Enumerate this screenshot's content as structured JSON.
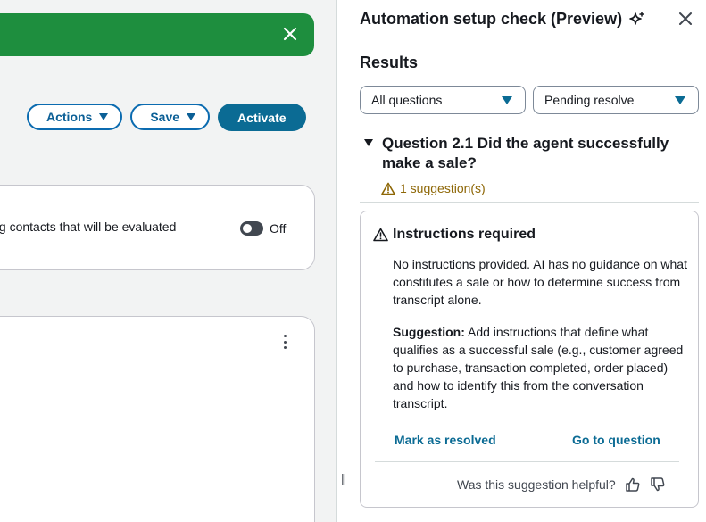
{
  "left": {
    "toolbar": {
      "actions_label": "Actions",
      "save_label": "Save",
      "activate_label": "Activate"
    },
    "card1": {
      "text": "ving contacts that will be evaluated",
      "toggle_state": "Off"
    }
  },
  "panel": {
    "title": "Automation setup check (Preview)",
    "results_heading": "Results",
    "filter1": "All questions",
    "filter2": "Pending resolve",
    "question": {
      "title": "Question 2.1 Did the agent successfully make a sale?",
      "suggestion_count": "1 suggestion(s)"
    },
    "suggestion": {
      "title": "Instructions required",
      "description": "No instructions provided. AI has no guidance on what constitutes a sale or how to determine success from transcript alone.",
      "suggestion_label": "Suggestion:",
      "suggestion_text": " Add instructions that define what qualifies as a successful sale (e.g., customer agreed to purchase, transaction completed, order placed) and how to identify this from the conversation transcript.",
      "mark_resolved": "Mark as resolved",
      "go_to_question": "Go to question",
      "helpful_prompt": "Was this suggestion helpful?"
    }
  },
  "colors": {
    "success": "#1e8e3e",
    "primary": "#0b6b94",
    "warning": "#8d6605"
  }
}
